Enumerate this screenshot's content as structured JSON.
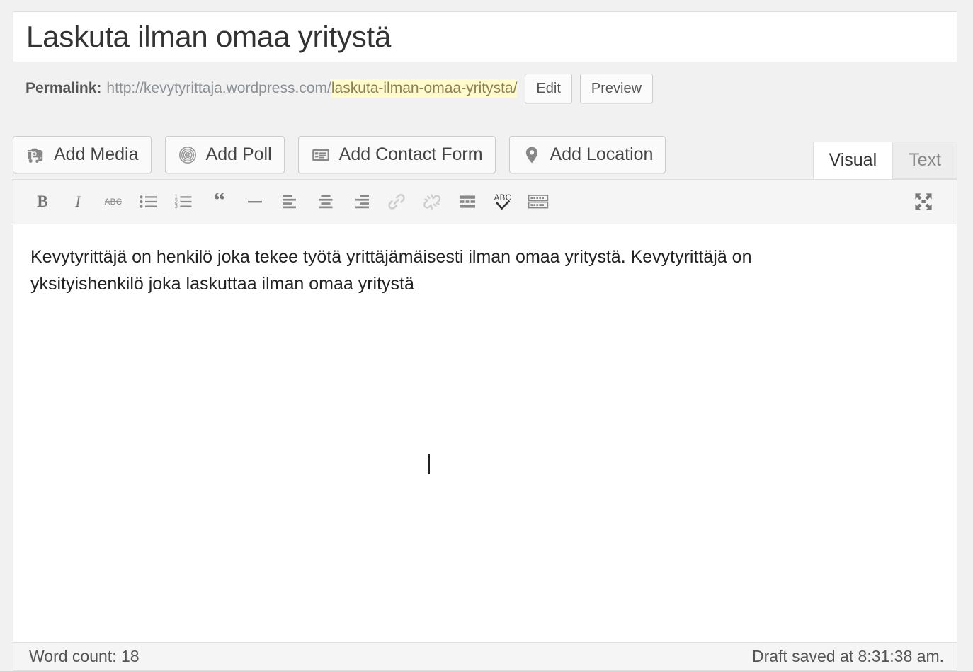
{
  "title": {
    "value": "Laskuta ilman omaa yritystä",
    "placeholder": "Enter title here"
  },
  "permalink": {
    "label": "Permalink:",
    "base_url": "http://kevytyrittaja.wordpress.com/",
    "slug": "laskuta-ilman-omaa-yritysta/",
    "highlight_color": "#fffbcc",
    "edit_button": "Edit",
    "preview_button": "Preview"
  },
  "media_buttons": [
    {
      "label": "Add Media",
      "icon": "camera-media-icon"
    },
    {
      "label": "Add Poll",
      "icon": "poll-circles-icon"
    },
    {
      "label": "Add Contact Form",
      "icon": "contact-form-icon"
    },
    {
      "label": "Add Location",
      "icon": "map-pin-icon"
    }
  ],
  "editor_tabs": [
    {
      "label": "Visual",
      "active": true
    },
    {
      "label": "Text",
      "active": false
    }
  ],
  "toolbar": [
    {
      "name": "bold",
      "icon": "bold-icon",
      "disabled": false
    },
    {
      "name": "italic",
      "icon": "italic-icon",
      "disabled": false
    },
    {
      "name": "strikethrough",
      "icon": "strikethrough-abc-icon",
      "disabled": false
    },
    {
      "name": "bulleted-list",
      "icon": "bulleted-list-icon",
      "disabled": false
    },
    {
      "name": "numbered-list",
      "icon": "numbered-list-icon",
      "disabled": false
    },
    {
      "name": "blockquote",
      "icon": "blockquote-icon",
      "disabled": false
    },
    {
      "name": "horizontal-rule",
      "icon": "horizontal-rule-icon",
      "disabled": false
    },
    {
      "name": "align-left",
      "icon": "align-left-icon",
      "disabled": false
    },
    {
      "name": "align-center",
      "icon": "align-center-icon",
      "disabled": false
    },
    {
      "name": "align-right",
      "icon": "align-right-icon",
      "disabled": false
    },
    {
      "name": "insert-link",
      "icon": "link-chain-icon",
      "disabled": true
    },
    {
      "name": "remove-link",
      "icon": "broken-chain-icon",
      "disabled": true
    },
    {
      "name": "insert-read-more",
      "icon": "read-more-icon",
      "disabled": false
    },
    {
      "name": "spellcheck",
      "icon": "spellcheck-abc-icon",
      "disabled": false
    },
    {
      "name": "keyboard-shortcuts",
      "icon": "keyboard-icon",
      "disabled": false
    }
  ],
  "toolbar_right": {
    "name": "fullscreen",
    "icon": "fullscreen-arrows-icon"
  },
  "content": {
    "body_text": "Kevytyrittäjä on henkilö joka tekee työtä yrittäjämäisesti ilman omaa yritystä. Kevytyrittäjä on yksityishenkilö joka laskuttaa ilman omaa yritystä"
  },
  "status": {
    "word_count": "Word count: 18",
    "draft_saved": "Draft saved at 8:31:38 am."
  },
  "colors": {
    "page_background": "#f1f1f1",
    "panel_border": "#dedede",
    "toolbar_background": "#f5f5f5",
    "icon_gray": "#888888",
    "text_dark": "#333333"
  }
}
